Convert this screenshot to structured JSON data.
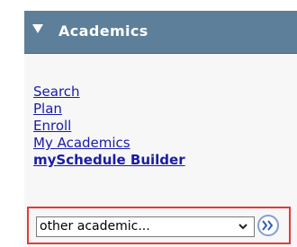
{
  "panel": {
    "title": "Academics",
    "header_color": "#5e7f99",
    "links": [
      {
        "label": "Search"
      },
      {
        "label": "Plan"
      },
      {
        "label": "Enroll"
      },
      {
        "label": "My Academics"
      },
      {
        "label": "mySchedule Builder"
      }
    ],
    "link_color": "#1a1ca6"
  },
  "select": {
    "value": "other academic..."
  },
  "icons": {
    "collapse": "triangle-down-icon",
    "dropdown": "chevron-down-icon",
    "go": "double-chevron-right-icon"
  },
  "highlight_color": "#e23a3a"
}
